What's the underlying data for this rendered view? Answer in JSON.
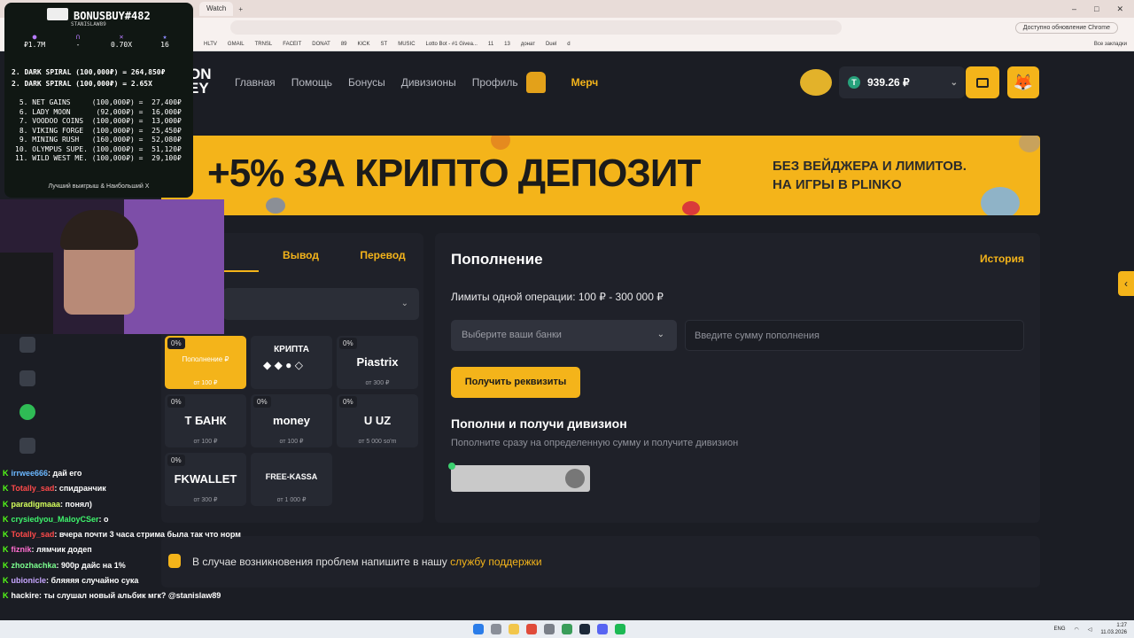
{
  "browser": {
    "tabs": [
      "Watch"
    ],
    "update_btn": "Доступно обновление Chrome",
    "all_bookmarks": "Все закладки",
    "bookmarks": [
      "HLTV",
      "GMAIL",
      "TRNSL",
      "FACEIT",
      "DONAT",
      "89",
      "KICK",
      "ST",
      "MUSIC",
      "Lotto Bot - #1 Givea...",
      "11",
      "13",
      "донат",
      "Duel",
      "d"
    ]
  },
  "site": {
    "logo": "ON\nEY",
    "nav": [
      "Главная",
      "Помощь",
      "Бонусы",
      "Дивизионы",
      "Профиль"
    ],
    "merch": "Мерч",
    "balance": "939.26 ₽",
    "tether_symbol": "T",
    "banner": {
      "headline": "+5% ЗА КРИПТО ДЕПОЗИТ",
      "sub_line1": "БЕЗ ВЕЙДЖЕРА И ЛИМИТОВ.",
      "sub_line2": "НА ИГРЫ В PLINKO"
    },
    "tabs": [
      "ение",
      "Вывод",
      "Перевод"
    ],
    "methods": [
      {
        "pct": "0%",
        "label": "Пополнение ₽",
        "min": "от 100 ₽"
      },
      {
        "pct": "",
        "label": "КРИПТА",
        "min": ""
      },
      {
        "pct": "0%",
        "label": "Piastrix",
        "min": "от 300 ₽"
      },
      {
        "pct": "0%",
        "label": "Т БАНК",
        "min": "от 100 ₽"
      },
      {
        "pct": "0%",
        "label": "money",
        "min": "от 100 ₽"
      },
      {
        "pct": "0%",
        "label": "U UZ",
        "min": "от 5 000 so'm"
      },
      {
        "pct": "0%",
        "label": "FKWALLET",
        "min": "от 300 ₽"
      },
      {
        "pct": "",
        "label": "FREE-KASSA",
        "min": "от 1 000 ₽"
      }
    ],
    "deposit": {
      "title": "Пополнение",
      "history": "История",
      "limits": "Лимиты одной операции: 100 ₽ - 300 000 ₽",
      "bank_placeholder": "Выберите ваши банки",
      "amount_placeholder": "Введите сумму пополнения",
      "get_button": "Получить реквизиты",
      "division_title": "Пополни и получи дивизион",
      "division_sub": "Пополните сразу на определенную сумму и получите дивизион"
    },
    "support": {
      "text": "В случае возникновения проблем напишите в нашу ",
      "link": "службу поддержки"
    }
  },
  "overlay": {
    "title": "BONUSBUY#482",
    "subtitle": "STANISLAW89",
    "stats": [
      "₽1.7M",
      "-",
      "0.70X",
      "16"
    ],
    "best1": "2. DARK SPIRAL (100,000₽) = 264,850₽",
    "best2": "2. DARK SPIRAL    (100,000₽) = 2.65X",
    "list": " 5. NET GAINS     (100,000₽) =  27,400₽\n 6. LADY MOON      (92,000₽) =  16,000₽\n 7. VOODOO COINS  (100,000₽) =  13,000₽\n 8. VIKING FORGE  (100,000₽) =  25,450₽\n 9. MINING RUSH   (160,000₽) =  52,080₽\n10. OLYMPUS SUPE. (100,000₽) =  51,120₽\n11. WILD WEST ME. (100,000₽) =  29,100₽",
    "footer": "Лучший выигрыш & Наибольший X"
  },
  "chat": [
    {
      "user": "irrwee666",
      "color": "#6bb7ff",
      "msg": "дай его"
    },
    {
      "user": "Totally_sad",
      "color": "#ff4a4a",
      "msg": "спидранчик"
    },
    {
      "user": "paradigmaaa",
      "color": "#d5ff5c",
      "msg": "понял)"
    },
    {
      "user": "crysiedyou_MaloyCSer",
      "color": "#3ef46c",
      "msg": "о"
    },
    {
      "user": "Totally_sad",
      "color": "#ff4a4a",
      "msg": "вчера почти 3 часа стрима была так что норм"
    },
    {
      "user": "fiznik",
      "color": "#ff6fd0",
      "msg": "лямчик додеп"
    },
    {
      "user": "zhozhachka",
      "color": "#7cff8f",
      "msg": "900р дайс на 1%"
    },
    {
      "user": "ubionicle",
      "color": "#c7a6ff",
      "msg": "бляяяя случайно сука"
    },
    {
      "user": "hackire",
      "color": "#ffffff",
      "msg": "ты слушал новый альбик мгк? @stanislaw89"
    }
  ],
  "taskbar": {
    "lang": "ENG",
    "time": "1:27",
    "date": "11.03.2026"
  }
}
